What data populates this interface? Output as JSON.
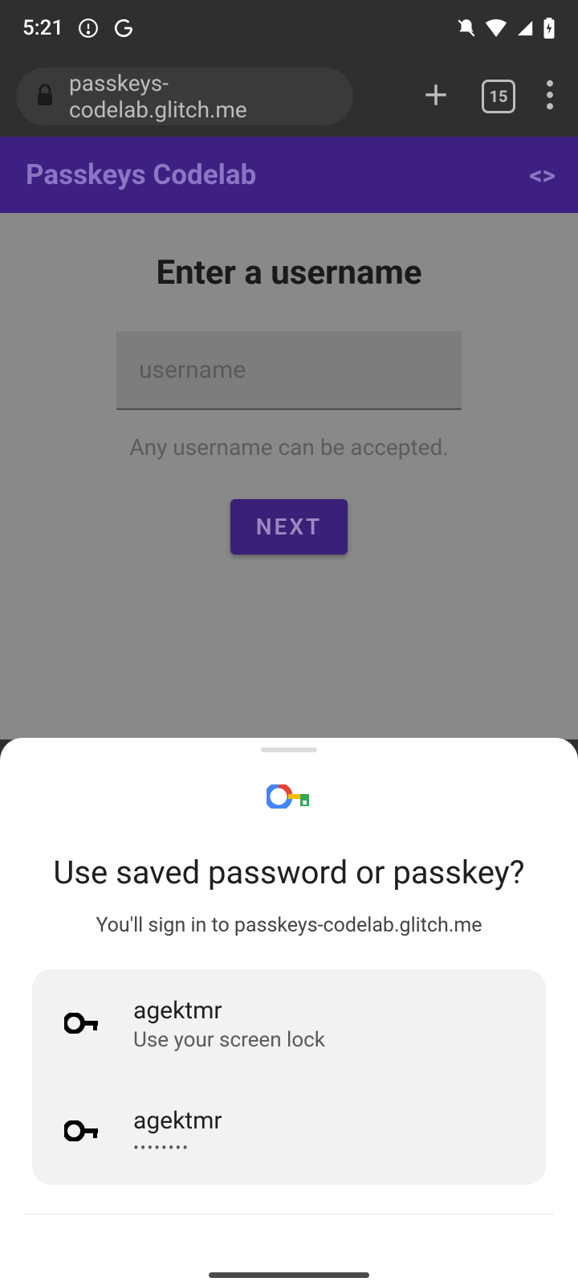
{
  "status": {
    "time": "5:21",
    "tab_count": "15"
  },
  "browser": {
    "url": "passkeys-codelab.glitch.me"
  },
  "page": {
    "app_title": "Passkeys Codelab",
    "heading": "Enter a username",
    "username_placeholder": "username",
    "hint": "Any username can be accepted.",
    "next": "NEXT"
  },
  "sheet": {
    "title": "Use saved password or passkey?",
    "subtitle": "You'll sign in to passkeys-codelab.glitch.me",
    "credentials": [
      {
        "username": "agektmr",
        "detail": "Use your screen lock",
        "type": "passkey"
      },
      {
        "username": "agektmr",
        "detail": "••••••••",
        "type": "password"
      }
    ]
  }
}
